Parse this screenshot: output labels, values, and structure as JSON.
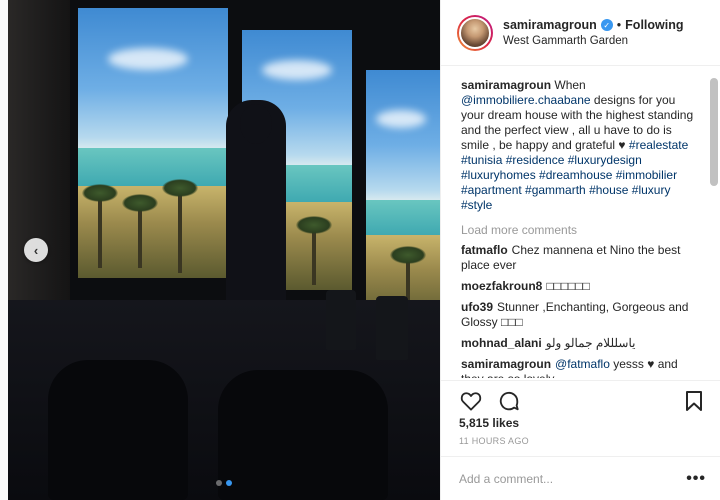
{
  "post": {
    "username": "samiramagroun",
    "verified_icon": "verified-badge-icon",
    "separator": "•",
    "follow_status": "Following",
    "location": "West Gammarth Garden",
    "caption": {
      "username": "samiramagroun",
      "text_before_mention": " When ",
      "mention": "@immobiliere.chaabane",
      "text_after_mention": " designs for you your dream house with the highest standing and the perfect view , all u have to do is smile , be happy and grateful ♥",
      "hashtags": "#realestate #tunisia #residence #luxurydesign #luxuryhomes #dreamhouse #immobilier #apartment #gammarth #house #luxury #style"
    },
    "load_more": "Load more comments",
    "comments": [
      {
        "user": "fatmaflo",
        "text": "Chez mannena et Nino the best place ever"
      },
      {
        "user": "moezfakroun8",
        "text": "□□□□□□"
      },
      {
        "user": "ufo39",
        "text": "Stunner ,Enchanting, Gorgeous and Glossy □□□"
      },
      {
        "user": "mohnad_alani",
        "text": "ياسلللام جمالو ولو"
      },
      {
        "user": "samiramagroun",
        "mention": "@fatmaflo",
        "text": " yesss ♥ and they are so lovely"
      }
    ],
    "likes": "5,815 likes",
    "time": "11 HOURS AGO",
    "add_comment_placeholder": "Add a comment...",
    "more_label": "•••"
  },
  "carousel": {
    "prev_label": "‹",
    "current_slide": 2,
    "total_slides": 2
  },
  "colors": {
    "link": "#003569",
    "accent": "#3897f0",
    "muted": "#999999"
  }
}
